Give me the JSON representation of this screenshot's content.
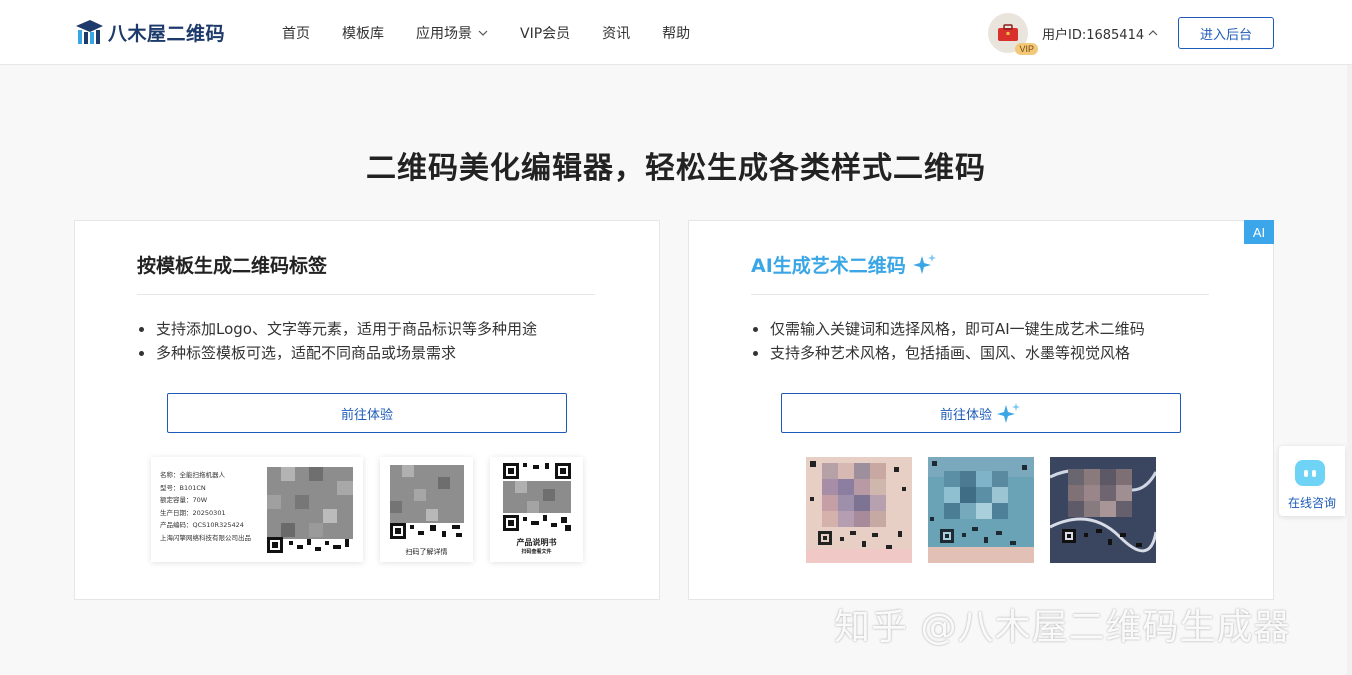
{
  "header": {
    "logo_text": "八木屋二维码",
    "nav": [
      {
        "label": "首页"
      },
      {
        "label": "模板库"
      },
      {
        "label": "应用场景"
      },
      {
        "label": "VIP会员"
      },
      {
        "label": "资讯"
      },
      {
        "label": "帮助"
      }
    ],
    "vip_badge": "VIP",
    "user_id": "用户ID:1685414",
    "backend_button": "进入后台"
  },
  "hero": {
    "title": "二维码美化编辑器，轻松生成各类样式二维码"
  },
  "card_template": {
    "title": "按模板生成二维码标签",
    "bullets": [
      "支持添加Logo、文字等元素，适用于商品标识等多种用途",
      "多种标签模板可选，适配不同商品或场景需求"
    ],
    "button": "前往体验",
    "label_sample": {
      "lines": [
        "名称：全能扫拖机器人",
        "型号：B101CN",
        "额定容量：70W",
        "生产日期：20250301",
        "产品编码：QCS10R325424",
        "上海闪擎网络科技有限公司出品"
      ]
    },
    "sample2_caption": "扫码了解详情",
    "sample3_caption_main": "产品说明书",
    "sample3_caption_sub": "扫码查看文件"
  },
  "card_ai": {
    "corner_badge": "AI",
    "title": "AI生成艺术二维码",
    "bullets": [
      "仅需输入关键词和选择风格，即可AI一键生成艺术二维码",
      "支持多种艺术风格，包括插画、国风、水墨等视觉风格"
    ],
    "button": "前往体验"
  },
  "float_chat": {
    "label": "在线咨询"
  },
  "watermark": "知乎 @八木屋二维码生成器",
  "colors": {
    "brand_blue": "#1e5bb8",
    "ai_blue": "#3aa6e6",
    "page_bg": "#f8f8f8"
  }
}
